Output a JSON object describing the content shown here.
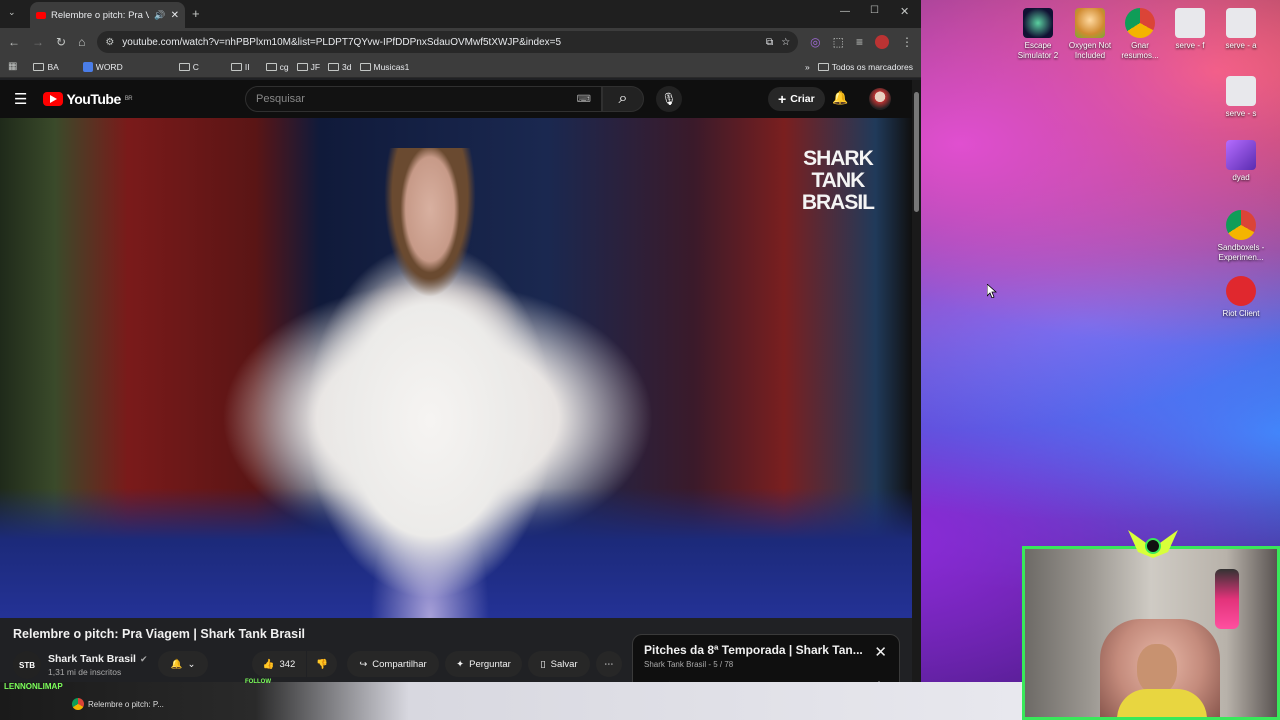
{
  "browser": {
    "tab_title": "Relembre o pitch: Pra Viagem",
    "url": "youtube.com/watch?v=nhPBPlxm10M&list=PLDPT7QYvw-IPfDDPnxSdauOVMwf5tXWJP&index=5",
    "bookmarks": [
      "BA",
      "WORD",
      "C",
      "II",
      "cg",
      "JF",
      "3d",
      "Musicas1"
    ],
    "all_bookmarks": "Todos os marcadores"
  },
  "youtube": {
    "logo_text": "YouTube",
    "region": "BR",
    "search_placeholder": "Pesquisar",
    "create_label": "Criar",
    "video_overlay": "SHARK\nTANK\nBRASIL",
    "video_title": "Relembre o pitch: Pra Viagem | Shark Tank Brasil",
    "channel_name": "Shark Tank Brasil",
    "channel_avatar_text": "STB",
    "subscribers": "1,31 mi de inscritos",
    "likes": "342",
    "share_label": "Compartilhar",
    "ask_label": "Perguntar",
    "save_label": "Salvar",
    "playlist": {
      "title": "Pitches da 8ª Temporada | Shark Tan...",
      "subtitle": "Shark Tank Brasil - 5 / 78"
    }
  },
  "desktop_icons": [
    {
      "label": "Escape Simulator 2"
    },
    {
      "label": "Oxygen Not Included"
    },
    {
      "label": "Gnar resumos..."
    },
    {
      "label": "serve - f"
    },
    {
      "label": "serve - a"
    },
    {
      "label": "serve - s"
    },
    {
      "label": "dyad"
    },
    {
      "label": "Sandboxels - Experimen..."
    },
    {
      "label": "Riot Client"
    }
  ],
  "stream": {
    "chat_user": "LENNONLIMAP",
    "follow": "FOLLOW",
    "taskbar_item": "Relembre o pitch: P..."
  },
  "colors": {
    "accent": "#ff0000",
    "webcam_border": "#39e85a"
  }
}
